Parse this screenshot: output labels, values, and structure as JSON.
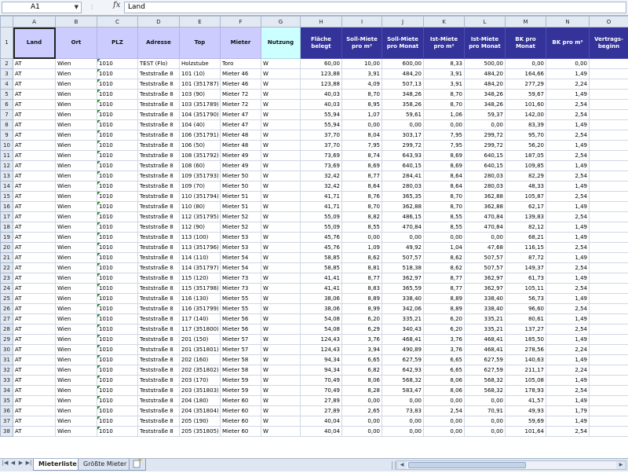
{
  "formula_bar": {
    "name_box": "A1",
    "fx_label": "fx",
    "formula": "Land"
  },
  "columns": [
    "A",
    "B",
    "C",
    "D",
    "E",
    "F",
    "G",
    "H",
    "I",
    "J",
    "K",
    "L",
    "M",
    "N",
    "O"
  ],
  "headers": [
    "Land",
    "Ort",
    "PLZ",
    "Adresse",
    "Top",
    "Mieter",
    "Nutzung",
    "Fläche belegt",
    "Soll-Miete pro m²",
    "Soll-Miete pro Monat",
    "Ist-Miete pro m²",
    "Ist-Miete pro Monat",
    "BK pro Monat",
    "BK pro m²",
    "Vertrags-beginn"
  ],
  "header_colors": {
    "lavender": "#ccccff",
    "cyan": "#ccffff",
    "navy": "#333399"
  },
  "rows": [
    [
      "AT",
      "Wien",
      "1010",
      "TEST (Flo)",
      "Holzstube",
      "Toro",
      "W",
      "60,00",
      "10,00",
      "600,00",
      "8,33",
      "500,00",
      "0,00",
      "0,00",
      ""
    ],
    [
      "AT",
      "Wien",
      "1010",
      "Teststraße 8",
      "101 (10)",
      "Mieter 46",
      "W",
      "123,88",
      "3,91",
      "484,20",
      "3,91",
      "484,20",
      "164,66",
      "1,49",
      ""
    ],
    [
      "AT",
      "Wien",
      "1010",
      "Teststraße 8",
      "101 (351787)",
      "Mieter 46",
      "W",
      "123,88",
      "4,09",
      "507,13",
      "3,91",
      "484,20",
      "277,29",
      "2,24",
      ""
    ],
    [
      "AT",
      "Wien",
      "1010",
      "Teststraße 8",
      "103 (90)",
      "Mieter 72",
      "W",
      "40,03",
      "8,70",
      "348,26",
      "8,70",
      "348,26",
      "59,67",
      "1,49",
      ""
    ],
    [
      "AT",
      "Wien",
      "1010",
      "Teststraße 8",
      "103 (351789)",
      "Mieter 72",
      "W",
      "40,03",
      "8,95",
      "358,26",
      "8,70",
      "348,26",
      "101,60",
      "2,54",
      ""
    ],
    [
      "AT",
      "Wien",
      "1010",
      "Teststraße 8",
      "104 (351790)",
      "Mieter 47",
      "W",
      "55,94",
      "1,07",
      "59,61",
      "1,06",
      "59,37",
      "142,00",
      "2,54",
      ""
    ],
    [
      "AT",
      "Wien",
      "1010",
      "Teststraße 8",
      "104 (40)",
      "Mieter 47",
      "W",
      "55,94",
      "0,00",
      "0,00",
      "0,00",
      "0,00",
      "83,39",
      "1,49",
      ""
    ],
    [
      "AT",
      "Wien",
      "1010",
      "Teststraße 8",
      "106 (351791)",
      "Mieter 48",
      "W",
      "37,70",
      "8,04",
      "303,17",
      "7,95",
      "299,72",
      "95,70",
      "2,54",
      ""
    ],
    [
      "AT",
      "Wien",
      "1010",
      "Teststraße 8",
      "106 (50)",
      "Mieter 48",
      "W",
      "37,70",
      "7,95",
      "299,72",
      "7,95",
      "299,72",
      "56,20",
      "1,49",
      ""
    ],
    [
      "AT",
      "Wien",
      "1010",
      "Teststraße 8",
      "108 (351792)",
      "Mieter 49",
      "W",
      "73,69",
      "8,74",
      "643,93",
      "8,69",
      "640,15",
      "187,05",
      "2,54",
      ""
    ],
    [
      "AT",
      "Wien",
      "1010",
      "Teststraße 8",
      "108 (60)",
      "Mieter 49",
      "W",
      "73,69",
      "8,69",
      "640,15",
      "8,69",
      "640,15",
      "109,85",
      "1,49",
      ""
    ],
    [
      "AT",
      "Wien",
      "1010",
      "Teststraße 8",
      "109 (351793)",
      "Mieter 50",
      "W",
      "32,42",
      "8,77",
      "284,41",
      "8,64",
      "280,03",
      "82,29",
      "2,54",
      ""
    ],
    [
      "AT",
      "Wien",
      "1010",
      "Teststraße 8",
      "109 (70)",
      "Mieter 50",
      "W",
      "32,42",
      "8,64",
      "280,03",
      "8,64",
      "280,03",
      "48,33",
      "1,49",
      ""
    ],
    [
      "AT",
      "Wien",
      "1010",
      "Teststraße 8",
      "110 (351794)",
      "Mieter 51",
      "W",
      "41,71",
      "8,76",
      "365,35",
      "8,70",
      "362,88",
      "105,87",
      "2,54",
      ""
    ],
    [
      "AT",
      "Wien",
      "1010",
      "Teststraße 8",
      "110 (80)",
      "Mieter 51",
      "W",
      "41,71",
      "8,70",
      "362,88",
      "8,70",
      "362,88",
      "62,17",
      "1,49",
      ""
    ],
    [
      "AT",
      "Wien",
      "1010",
      "Teststraße 8",
      "112 (351795)",
      "Mieter 52",
      "W",
      "55,09",
      "8,82",
      "486,15",
      "8,55",
      "470,84",
      "139,83",
      "2,54",
      ""
    ],
    [
      "AT",
      "Wien",
      "1010",
      "Teststraße 8",
      "112 (90)",
      "Mieter 52",
      "W",
      "55,09",
      "8,55",
      "470,84",
      "8,55",
      "470,84",
      "82,12",
      "1,49",
      ""
    ],
    [
      "AT",
      "Wien",
      "1010",
      "Teststraße 8",
      "113 (100)",
      "Mieter 53",
      "W",
      "45,76",
      "0,00",
      "0,00",
      "0,00",
      "0,00",
      "68,21",
      "1,49",
      ""
    ],
    [
      "AT",
      "Wien",
      "1010",
      "Teststraße 8",
      "113 (351796)",
      "Mieter 53",
      "W",
      "45,76",
      "1,09",
      "49,92",
      "1,04",
      "47,68",
      "116,15",
      "2,54",
      ""
    ],
    [
      "AT",
      "Wien",
      "1010",
      "Teststraße 8",
      "114 (110)",
      "Mieter 54",
      "W",
      "58,85",
      "8,62",
      "507,57",
      "8,62",
      "507,57",
      "87,72",
      "1,49",
      ""
    ],
    [
      "AT",
      "Wien",
      "1010",
      "Teststraße 8",
      "114 (351797)",
      "Mieter 54",
      "W",
      "58,85",
      "8,81",
      "518,38",
      "8,62",
      "507,57",
      "149,37",
      "2,54",
      ""
    ],
    [
      "AT",
      "Wien",
      "1010",
      "Teststraße 8",
      "115 (120)",
      "Mieter 73",
      "W",
      "41,41",
      "8,77",
      "362,97",
      "8,77",
      "362,97",
      "61,73",
      "1,49",
      ""
    ],
    [
      "AT",
      "Wien",
      "1010",
      "Teststraße 8",
      "115 (351798)",
      "Mieter 73",
      "W",
      "41,41",
      "8,83",
      "365,59",
      "8,77",
      "362,97",
      "105,11",
      "2,54",
      ""
    ],
    [
      "AT",
      "Wien",
      "1010",
      "Teststraße 8",
      "116 (130)",
      "Mieter 55",
      "W",
      "38,06",
      "8,89",
      "338,40",
      "8,89",
      "338,40",
      "56,73",
      "1,49",
      ""
    ],
    [
      "AT",
      "Wien",
      "1010",
      "Teststraße 8",
      "116 (351799)",
      "Mieter 55",
      "W",
      "38,06",
      "8,99",
      "342,06",
      "8,89",
      "338,40",
      "96,60",
      "2,54",
      ""
    ],
    [
      "AT",
      "Wien",
      "1010",
      "Teststraße 8",
      "117 (140)",
      "Mieter 56",
      "W",
      "54,08",
      "6,20",
      "335,21",
      "6,20",
      "335,21",
      "80,61",
      "1,49",
      ""
    ],
    [
      "AT",
      "Wien",
      "1010",
      "Teststraße 8",
      "117 (351800)",
      "Mieter 56",
      "W",
      "54,08",
      "6,29",
      "340,43",
      "6,20",
      "335,21",
      "137,27",
      "2,54",
      ""
    ],
    [
      "AT",
      "Wien",
      "1010",
      "Teststraße 8",
      "201 (150)",
      "Mieter 57",
      "W",
      "124,43",
      "3,76",
      "468,41",
      "3,76",
      "468,41",
      "185,50",
      "1,49",
      ""
    ],
    [
      "AT",
      "Wien",
      "1010",
      "Teststraße 8",
      "201 (351801)",
      "Mieter 57",
      "W",
      "124,43",
      "3,94",
      "490,89",
      "3,76",
      "468,41",
      "278,56",
      "2,24",
      ""
    ],
    [
      "AT",
      "Wien",
      "1010",
      "Teststraße 8",
      "202 (160)",
      "Mieter 58",
      "W",
      "94,34",
      "6,65",
      "627,59",
      "6,65",
      "627,59",
      "140,63",
      "1,49",
      ""
    ],
    [
      "AT",
      "Wien",
      "1010",
      "Teststraße 8",
      "202 (351802)",
      "Mieter 58",
      "W",
      "94,34",
      "6,82",
      "642,93",
      "6,65",
      "627,59",
      "211,17",
      "2,24",
      ""
    ],
    [
      "AT",
      "Wien",
      "1010",
      "Teststraße 8",
      "203 (170)",
      "Mieter 59",
      "W",
      "70,49",
      "8,06",
      "568,32",
      "8,06",
      "568,32",
      "105,08",
      "1,49",
      ""
    ],
    [
      "AT",
      "Wien",
      "1010",
      "Teststraße 8",
      "203 (351803)",
      "Mieter 59",
      "W",
      "70,49",
      "8,28",
      "583,47",
      "8,06",
      "568,32",
      "178,93",
      "2,54",
      ""
    ],
    [
      "AT",
      "Wien",
      "1010",
      "Teststraße 8",
      "204 (180)",
      "Mieter 60",
      "W",
      "27,89",
      "0,00",
      "0,00",
      "0,00",
      "0,00",
      "41,57",
      "1,49",
      ""
    ],
    [
      "AT",
      "Wien",
      "1010",
      "Teststraße 8",
      "204 (351804)",
      "Mieter 60",
      "W",
      "27,89",
      "2,65",
      "73,83",
      "2,54",
      "70,91",
      "49,93",
      "1,79",
      ""
    ],
    [
      "AT",
      "Wien",
      "1010",
      "Teststraße 8",
      "205 (190)",
      "Mieter 60",
      "W",
      "40,04",
      "0,00",
      "0,00",
      "0,00",
      "0,00",
      "59,69",
      "1,49",
      ""
    ],
    [
      "AT",
      "Wien",
      "1010",
      "Teststraße 8",
      "205 (351805)",
      "Mieter 60",
      "W",
      "40,04",
      "0,00",
      "0,00",
      "0,00",
      "0,00",
      "101,64",
      "2,54",
      ""
    ]
  ],
  "sheet_tabs": [
    {
      "label": "Mieterliste",
      "active": true
    },
    {
      "label": "Größte Mieter",
      "active": false
    }
  ]
}
